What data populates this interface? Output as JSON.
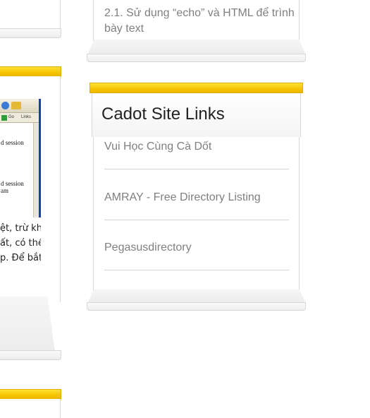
{
  "left_column": {
    "screenshot_snippet": {
      "address_go": "Go",
      "address_links": "Links",
      "line1": "d session",
      "line2": "d session",
      "line3": "am"
    },
    "paragraph_lines": [
      "ệt, trừ khi",
      "ất, có thể",
      "p. Để bắt"
    ]
  },
  "right_top_card": {
    "link_text": "2.1. Sử dụng “echo” và HTML để trình bày text"
  },
  "site_links": {
    "title": "Cadot Site Links",
    "items": [
      {
        "label": "Vui Học Cùng Cà Dốt"
      },
      {
        "label": "AMRAY - Free Directory Listing"
      },
      {
        "label": "Pegasusdirectory"
      }
    ]
  },
  "colors": {
    "accent_bar": "#f5c400",
    "link_text": "#808080",
    "title_text": "#222222"
  }
}
